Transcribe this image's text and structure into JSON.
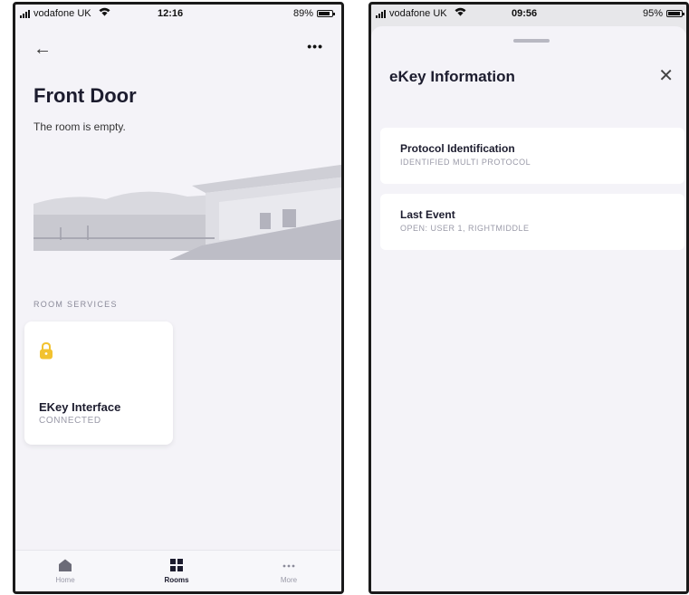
{
  "left_screen": {
    "status_bar": {
      "carrier": "vodafone UK",
      "time": "12:16",
      "battery_pct": "89%",
      "battery_level": 0.89
    },
    "header": {
      "back_icon": "back-arrow-icon",
      "more_icon": "more-icon",
      "back_glyph": "←",
      "more_glyph": "•••"
    },
    "title": "Front Door",
    "subtitle": "The room is empty.",
    "section_label": "ROOM SERVICES",
    "service_card": {
      "title": "EKey Interface",
      "status": "CONNECTED",
      "icon": "lock-icon",
      "icon_color": "#f2c230"
    },
    "tabs": [
      {
        "label": "Home",
        "icon": "home-icon",
        "active": false
      },
      {
        "label": "Rooms",
        "icon": "rooms-icon",
        "active": true
      },
      {
        "label": "More",
        "icon": "more-icon",
        "active": false
      }
    ]
  },
  "right_screen": {
    "status_bar": {
      "carrier": "vodafone UK",
      "time": "09:56",
      "battery_pct": "95%",
      "battery_level": 0.95
    },
    "sheet_title": "eKey Information",
    "close_glyph": "✕",
    "cards": [
      {
        "title": "Protocol Identification",
        "value": "IDENTIFIED MULTI PROTOCOL"
      },
      {
        "title": "Last Event",
        "value": "OPEN: USER 1, RIGHTMIDDLE"
      }
    ]
  }
}
